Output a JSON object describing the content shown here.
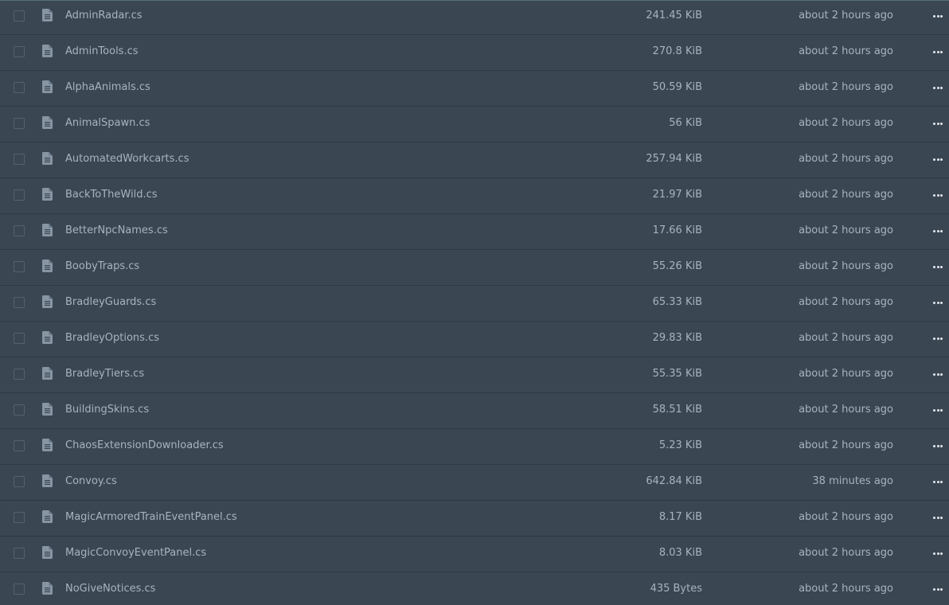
{
  "files": [
    {
      "name": "AdminRadar.cs",
      "size": "241.45 KiB",
      "modified": "about 2 hours ago"
    },
    {
      "name": "AdminTools.cs",
      "size": "270.8 KiB",
      "modified": "about 2 hours ago"
    },
    {
      "name": "AlphaAnimals.cs",
      "size": "50.59 KiB",
      "modified": "about 2 hours ago"
    },
    {
      "name": "AnimalSpawn.cs",
      "size": "56 KiB",
      "modified": "about 2 hours ago"
    },
    {
      "name": "AutomatedWorkcarts.cs",
      "size": "257.94 KiB",
      "modified": "about 2 hours ago"
    },
    {
      "name": "BackToTheWild.cs",
      "size": "21.97 KiB",
      "modified": "about 2 hours ago"
    },
    {
      "name": "BetterNpcNames.cs",
      "size": "17.66 KiB",
      "modified": "about 2 hours ago"
    },
    {
      "name": "BoobyTraps.cs",
      "size": "55.26 KiB",
      "modified": "about 2 hours ago"
    },
    {
      "name": "BradleyGuards.cs",
      "size": "65.33 KiB",
      "modified": "about 2 hours ago"
    },
    {
      "name": "BradleyOptions.cs",
      "size": "29.83 KiB",
      "modified": "about 2 hours ago"
    },
    {
      "name": "BradleyTiers.cs",
      "size": "55.35 KiB",
      "modified": "about 2 hours ago"
    },
    {
      "name": "BuildingSkins.cs",
      "size": "58.51 KiB",
      "modified": "about 2 hours ago"
    },
    {
      "name": "ChaosExtensionDownloader.cs",
      "size": "5.23 KiB",
      "modified": "about 2 hours ago"
    },
    {
      "name": "Convoy.cs",
      "size": "642.84 KiB",
      "modified": "38 minutes ago"
    },
    {
      "name": "MagicArmoredTrainEventPanel.cs",
      "size": "8.17 KiB",
      "modified": "about 2 hours ago"
    },
    {
      "name": "MagicConvoyEventPanel.cs",
      "size": "8.03 KiB",
      "modified": "about 2 hours ago"
    },
    {
      "name": "NoGiveNotices.cs",
      "size": "435 Bytes",
      "modified": "about 2 hours ago"
    }
  ],
  "icons": {
    "file": "file-icon",
    "more": "more-horizontal-icon",
    "checkbox": "checkbox-unchecked"
  },
  "colors": {
    "background": "#3b4653",
    "text": "#a7b3bf",
    "icon": "#8795a3",
    "divider": "#2f3943"
  }
}
